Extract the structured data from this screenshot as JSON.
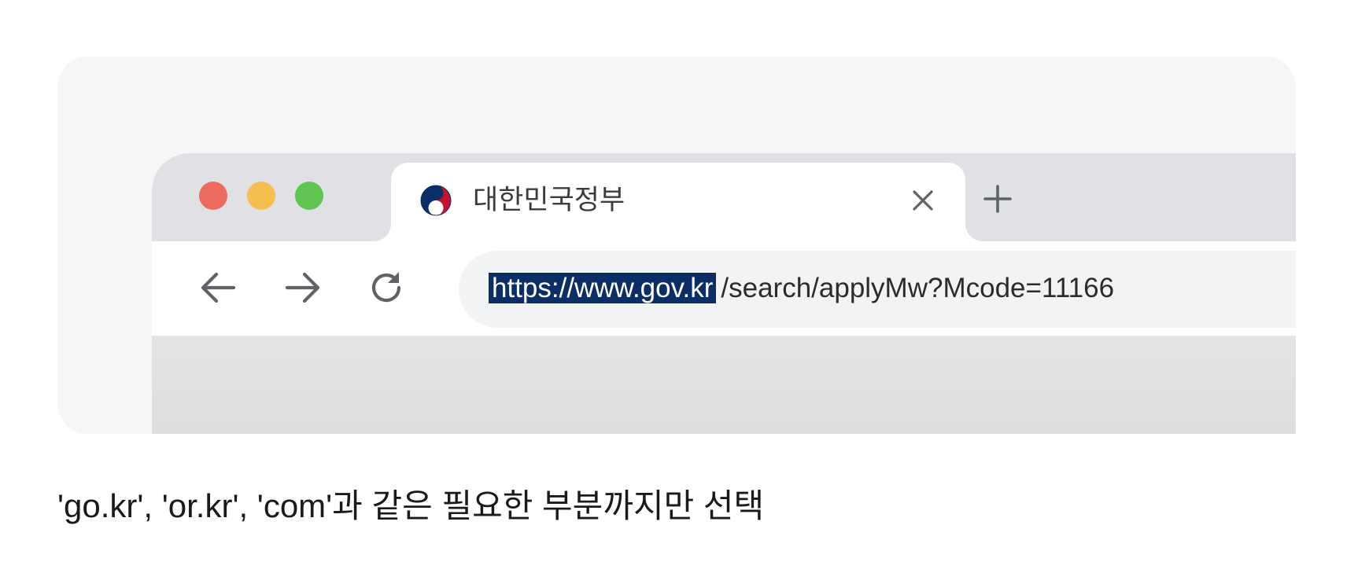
{
  "browser": {
    "window_controls": [
      "close",
      "minimize",
      "maximize"
    ],
    "tab": {
      "favicon": "korea-government-emblem-icon",
      "title": "대한민국정부",
      "close_icon": "close-icon"
    },
    "new_tab_icon": "plus-icon",
    "toolbar": {
      "back_icon": "back-arrow-icon",
      "forward_icon": "forward-arrow-icon",
      "reload_icon": "reload-icon"
    },
    "address_bar": {
      "url_host_selected": "https://www.gov.kr",
      "url_path": "/search/applyMw?Mcode=11166"
    }
  },
  "caption": "'go.kr', 'or.kr', 'com'과 같은 필요한 부분까지만 선택",
  "colors": {
    "selection_highlight": "#0b2e66",
    "traffic_red": "#ed6a5e",
    "traffic_yellow": "#f4bf4f",
    "traffic_green": "#61c554"
  }
}
